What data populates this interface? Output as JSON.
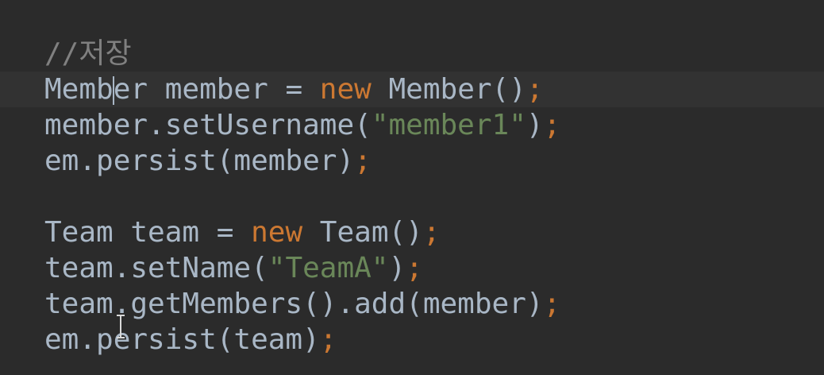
{
  "editor": {
    "lines": [
      {
        "tokens": [
          {
            "t": "comment",
            "v": "//저장"
          }
        ]
      },
      {
        "current": true,
        "tokens": [
          {
            "t": "plain",
            "v": "Memb"
          },
          {
            "t": "caret",
            "v": ""
          },
          {
            "t": "plain",
            "v": "er member = "
          },
          {
            "t": "kw",
            "v": "new"
          },
          {
            "t": "plain",
            "v": " Member()"
          },
          {
            "t": "punct",
            "v": ";"
          }
        ]
      },
      {
        "tokens": [
          {
            "t": "plain",
            "v": "member.setUsername("
          },
          {
            "t": "str",
            "v": "\"member1\""
          },
          {
            "t": "plain",
            "v": ")"
          },
          {
            "t": "punct",
            "v": ";"
          }
        ]
      },
      {
        "tokens": [
          {
            "t": "plain",
            "v": "em.persist(member)"
          },
          {
            "t": "punct",
            "v": ";"
          }
        ]
      },
      {
        "tokens": []
      },
      {
        "tokens": [
          {
            "t": "plain",
            "v": "Team team = "
          },
          {
            "t": "kw",
            "v": "new"
          },
          {
            "t": "plain",
            "v": " Team()"
          },
          {
            "t": "punct",
            "v": ";"
          }
        ]
      },
      {
        "tokens": [
          {
            "t": "plain",
            "v": "team.setName("
          },
          {
            "t": "str",
            "v": "\"TeamA\""
          },
          {
            "t": "plain",
            "v": ")"
          },
          {
            "t": "punct",
            "v": ";"
          }
        ]
      },
      {
        "tokens": [
          {
            "t": "plain",
            "v": "team.getMembers().add(member)"
          },
          {
            "t": "punct",
            "v": ";"
          }
        ]
      },
      {
        "tokens": [
          {
            "t": "plain",
            "v": "em.persist(team)"
          },
          {
            "t": "punct",
            "v": ";"
          }
        ]
      }
    ]
  },
  "colors": {
    "background": "#2b2b2b",
    "current_line": "#323232",
    "plain": "#a9b7c6",
    "keyword": "#cc7832",
    "string": "#6a8759",
    "comment": "#808080"
  }
}
